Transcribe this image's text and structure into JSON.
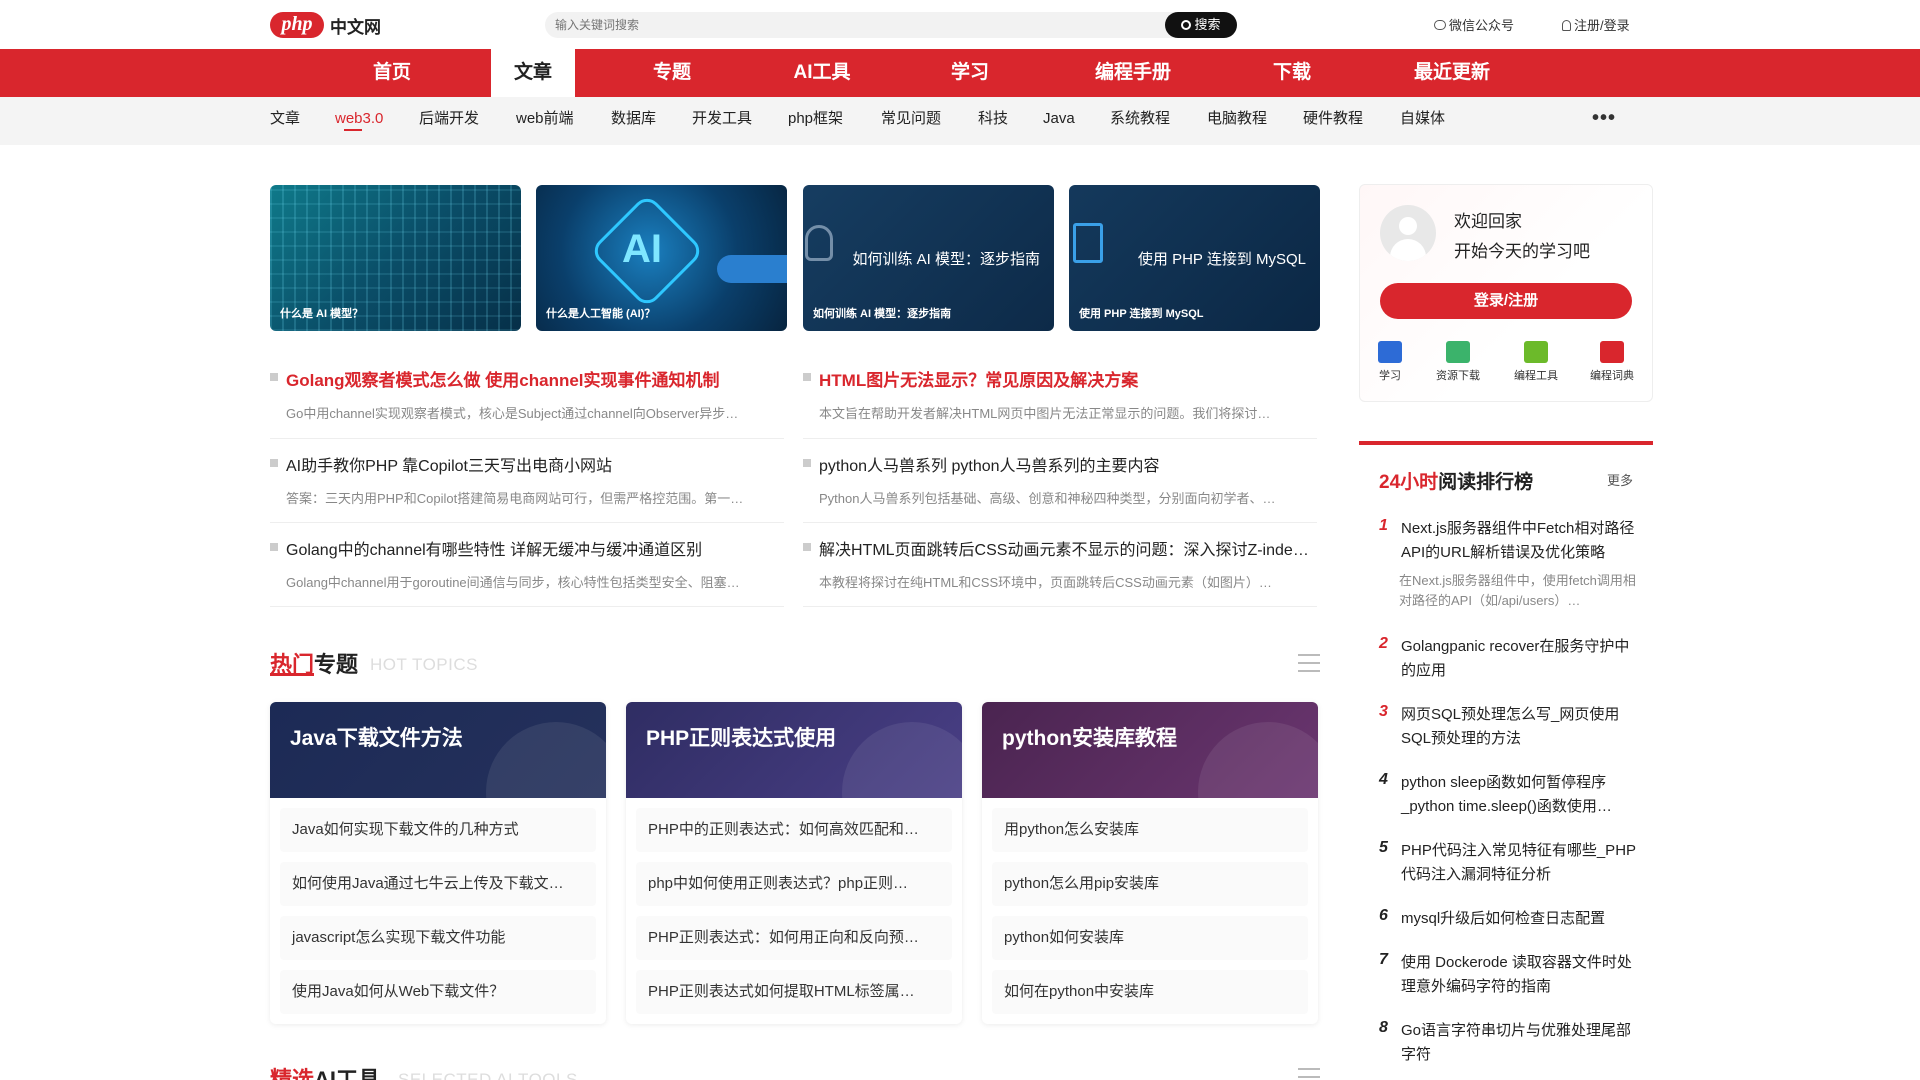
{
  "header": {
    "logo_mark": "php",
    "logo_text": "中文网",
    "search_placeholder": "输入关键词搜索",
    "search_button": "搜索",
    "wechat": "微信公众号",
    "login": "注册/登录"
  },
  "nav": {
    "items": [
      "首页",
      "文章",
      "专题",
      "AI工具",
      "学习",
      "编程手册",
      "下载",
      "最近更新"
    ],
    "active": "文章"
  },
  "subnav": {
    "items": [
      "文章",
      "web3.0",
      "后端开发",
      "web前端",
      "数据库",
      "开发工具",
      "php框架",
      "常见问题",
      "科技",
      "Java",
      "系统教程",
      "电脑教程",
      "硬件教程",
      "自媒体"
    ],
    "active": "web3.0",
    "more": "•••"
  },
  "banners": [
    {
      "caption": "什么是 AI 模型？",
      "center": ""
    },
    {
      "caption": "什么是人工智能 (AI)？",
      "center": "AI"
    },
    {
      "caption": "如何训练 AI 模型：逐步指南",
      "center": "如何训练 AI 模型：逐步指南"
    },
    {
      "caption": "使用 PHP 连接到 MySQL",
      "center": "使用 PHP 连接到 MySQL"
    }
  ],
  "articles": [
    {
      "title": "Golang观察者模式怎么做 使用channel实现事件通知机制",
      "desc": "Go中用channel实现观察者模式，核心是Subject通过channel向Observer异步…",
      "hot": true
    },
    {
      "title": "HTML图片无法显示？常见原因及解决方案",
      "desc": "本文旨在帮助开发者解决HTML网页中图片无法正常显示的问题。我们将探讨…",
      "hot": true
    },
    {
      "title": "AI助手教你PHP 靠Copilot三天写出电商小网站",
      "desc": "答案：三天内用PHP和Copilot搭建简易电商网站可行，但需严格控范围。第一…",
      "hot": false
    },
    {
      "title": "python人马兽系列 python人马兽系列的主要内容",
      "desc": "Python人马兽系列包括基础、高级、创意和神秘四种类型，分别面向初学者、…",
      "hot": false
    },
    {
      "title": "Golang中的channel有哪些特性 详解无缓冲与缓冲通道区别",
      "desc": "Golang中channel用于goroutine间通信与同步，核心特性包括类型安全、阻塞…",
      "hot": false
    },
    {
      "title": "解决HTML页面跳转后CSS动画元素不显示的问题：深入探讨Z-index…",
      "desc": "本教程将探讨在纯HTML和CSS环境中，页面跳转后CSS动画元素（如图片）…",
      "hot": false
    }
  ],
  "hot_topics": {
    "title_red": "热门",
    "title_rest": "专题",
    "en": "HOT TOPICS",
    "cards": [
      {
        "title": "Java下载文件方法",
        "color": "#1f2a4f",
        "items": [
          "Java如何实现下载文件的几种方式",
          "如何使用Java通过七牛云上传及下载文…",
          "javascript怎么实现下载文件功能",
          "使用Java如何从Web下载文件？"
        ]
      },
      {
        "title": "PHP正则表达式使用",
        "color": "#3f3670",
        "items": [
          "PHP中的正则表达式：如何高效匹配和…",
          "php中如何使用正则表达式？php正则…",
          "PHP正则表达式：如何用正向和反向预…",
          "PHP正则表达式如何提取HTML标签属…"
        ]
      },
      {
        "title": "python安装库教程",
        "color": "#5a2b58",
        "items": [
          "用python怎么安装库",
          "python怎么用pip安装库",
          "python如何安装库",
          "如何在python中安装库"
        ]
      }
    ]
  },
  "selected_ai": {
    "title_red": "精选",
    "title_rest": "AI工具",
    "en": "SELECTED AI TOOLS"
  },
  "sidebar": {
    "greet1": "欢迎回家",
    "greet2": "开始今天的学习吧",
    "login_button": "登录/注册",
    "quick": [
      {
        "label": "学习",
        "color": "#2d6bd6"
      },
      {
        "label": "资源下载",
        "color": "#3bb36b"
      },
      {
        "label": "编程工具",
        "color": "#6cba2a"
      },
      {
        "label": "编程词典",
        "color": "#d9262d"
      }
    ]
  },
  "ranking": {
    "title_red": "24小时",
    "title_rest": "阅读排行榜",
    "more": "更多",
    "items": [
      {
        "num": "1",
        "text": "Next.js服务器组件中Fetch相对路径API的URL解析错误及优化策略",
        "desc": "在Next.js服务器组件中，使用fetch调用相对路径的API（如/api/users）…"
      },
      {
        "num": "2",
        "text": "Golangpanic recover在服务守护中的应用",
        "desc": ""
      },
      {
        "num": "3",
        "text": "网页SQL预处理怎么写_网页使用SQL预处理的方法",
        "desc": ""
      },
      {
        "num": "4",
        "text": "python sleep函数如何暂停程序_python time.sleep()函数使用…",
        "desc": ""
      },
      {
        "num": "5",
        "text": "PHP代码注入常见特征有哪些_PHP代码注入漏洞特征分析",
        "desc": ""
      },
      {
        "num": "6",
        "text": "mysql升级后如何检查日志配置",
        "desc": ""
      },
      {
        "num": "7",
        "text": "使用 Dockerode 读取容器文件时处理意外编码字符的指南",
        "desc": ""
      },
      {
        "num": "8",
        "text": "Go语言字符串切片与优雅处理尾部字符",
        "desc": ""
      }
    ]
  }
}
